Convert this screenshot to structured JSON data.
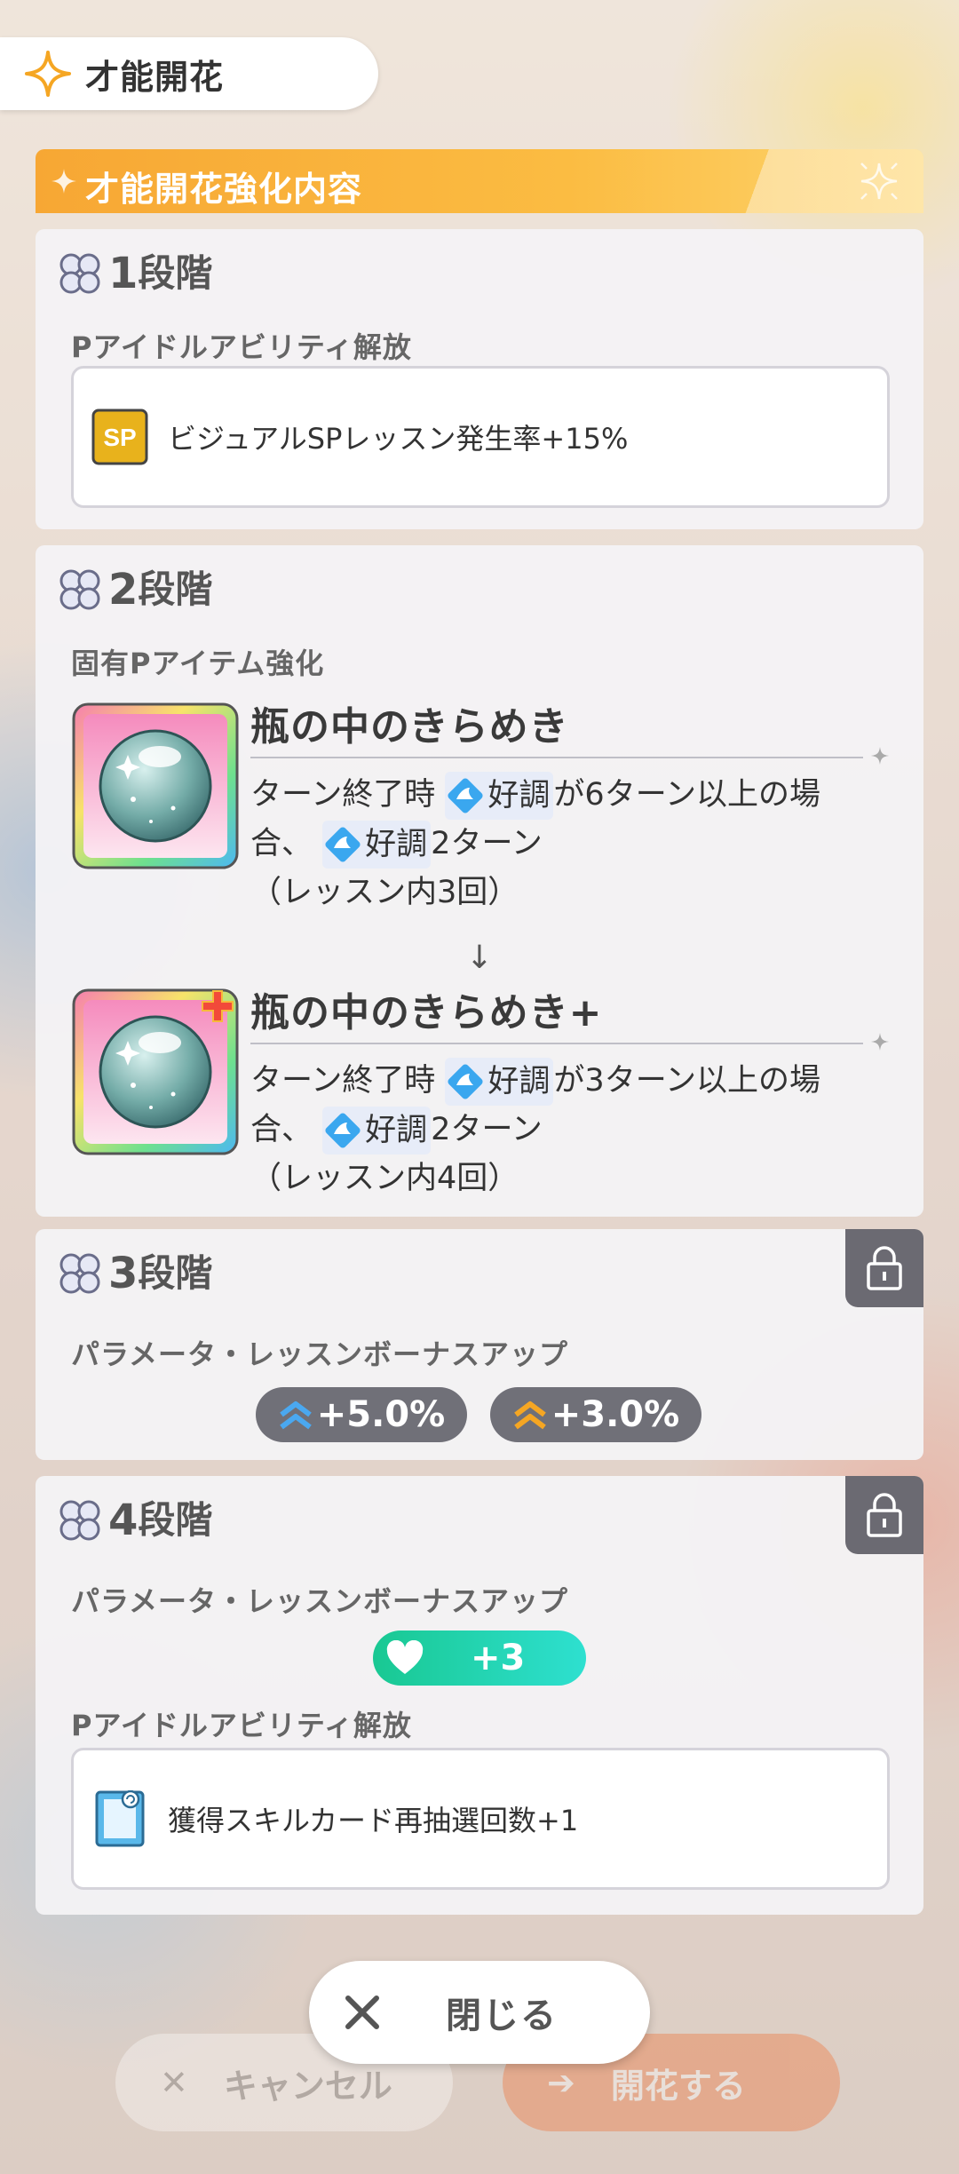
{
  "header": {
    "title": "才能開花"
  },
  "banner": {
    "title": "才能開花強化内容"
  },
  "stages": [
    {
      "num": "1",
      "suffix": "段階",
      "sections": [
        {
          "label": "Pアイドルアビリティ解放",
          "ability_icon": "sp-icon",
          "ability_text": "ビジュアルSPレッスン発生率+15%"
        }
      ]
    },
    {
      "num": "2",
      "suffix": "段階",
      "label": "固有Pアイテム強化",
      "before": {
        "name": "瓶の中のきらめき",
        "desc_prefix": "ターン終了時",
        "tag1": "好調",
        "desc_mid": "が6ターン以上の場合、",
        "tag2": "好調",
        "desc_after": "2ターン",
        "desc_note": "（レッスン内3回）"
      },
      "arrow": "↓",
      "after": {
        "name": "瓶の中のきらめき+",
        "desc_prefix": "ターン終了時",
        "tag1": "好調",
        "desc_mid": "が3ターン以上の場合、",
        "tag2": "好調",
        "desc_after": "2ターン",
        "desc_note": "（レッスン内4回）"
      }
    },
    {
      "num": "3",
      "suffix": "段階",
      "label": "パラメータ・レッスンボーナスアップ",
      "bonuses": [
        {
          "value": "+5.0%",
          "color": "#4aa8f0",
          "icon": "double-chevron-up-icon"
        },
        {
          "value": "+3.0%",
          "color": "#f5a623",
          "icon": "double-chevron-up-icon"
        }
      ],
      "locked": true
    },
    {
      "num": "4",
      "suffix": "段階",
      "label": "パラメータ・レッスンボーナスアップ",
      "heart_value": "+3",
      "label2": "Pアイドルアビリティ解放",
      "ability_text": "獲得スキルカード再抽選回数+1",
      "locked": true
    }
  ],
  "buttons": {
    "close_label": "閉じる",
    "cancel_label": "キャンセル",
    "confirm_label": "開花する"
  },
  "colors": {
    "accent": "#f7a734",
    "stage_bg": "#f4f3f5",
    "lock_bg": "#6b6a72",
    "heart_pill": "#19c892"
  }
}
